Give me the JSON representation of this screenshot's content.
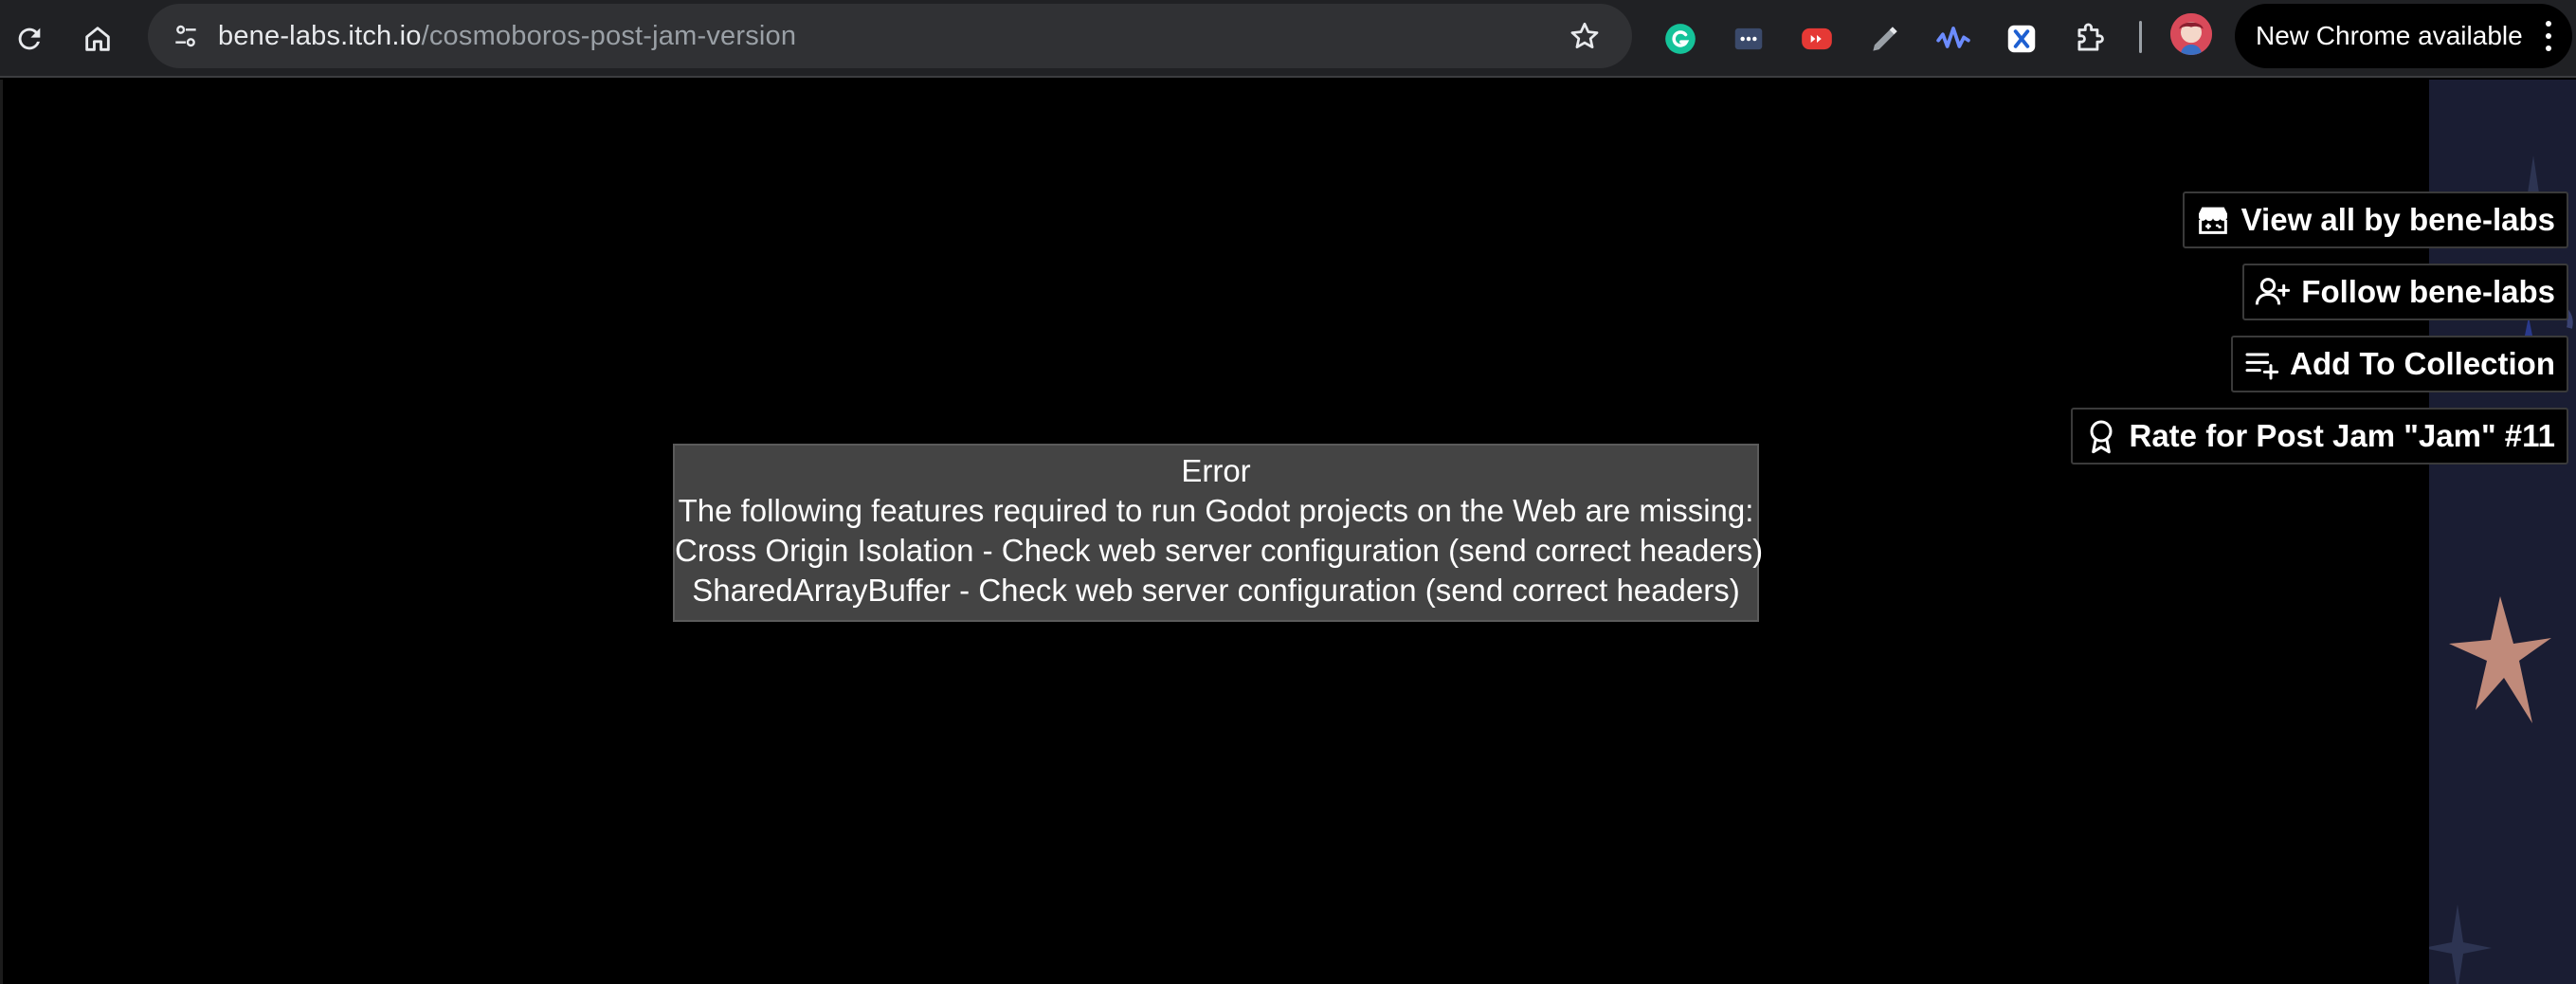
{
  "browser": {
    "url_host": "bene-labs.itch.io",
    "url_path": "/cosmoboros-post-jam-version",
    "update_chip_label": "New Chrome available",
    "extensions": [
      "grammarly-icon",
      "dots-extension-icon",
      "youtube-extension-icon",
      "pen-icon",
      "waveform-icon",
      "x-extension-icon",
      "puzzle-icon"
    ]
  },
  "game_actions": {
    "view_all": "View all by bene-labs",
    "follow": "Follow bene-labs",
    "add_to_collection": "Add To Collection",
    "rate": "Rate for Post Jam \"Jam\" #11"
  },
  "error": {
    "title": "Error",
    "lines": [
      "The following features required to run Godot projects on the Web are missing:",
      "Cross Origin Isolation - Check web server configuration (send correct headers)",
      "SharedArrayBuffer - Check web server configuration (send correct headers)"
    ]
  },
  "colors": {
    "toolbar": "#202124",
    "omnibox": "#303134",
    "error_bg": "#444444",
    "side_bg": "#1a1d33"
  }
}
